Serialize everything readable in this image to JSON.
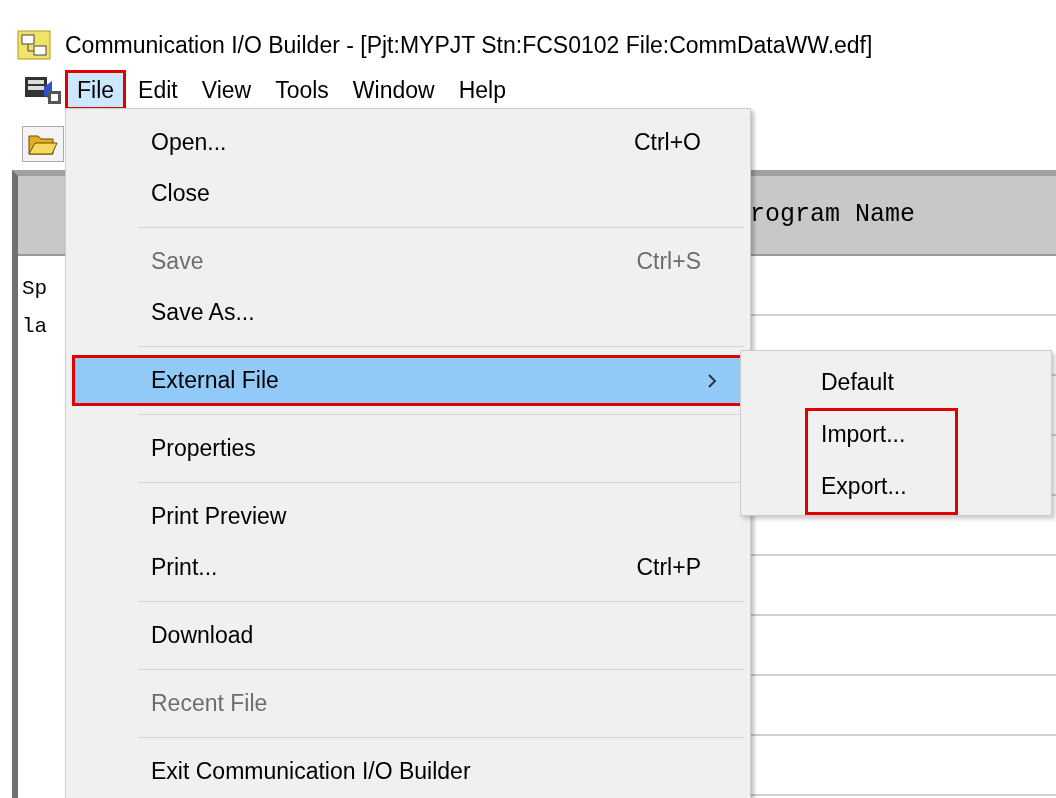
{
  "window": {
    "title": "Communication I/O Builder - [Pjt:MYPJT Stn:FCS0102 File:CommDataWW.edf]"
  },
  "menubar": [
    {
      "label": "File",
      "selected": true,
      "highlighted": true
    },
    {
      "label": "Edit",
      "selected": false,
      "highlighted": false
    },
    {
      "label": "View",
      "selected": false,
      "highlighted": false
    },
    {
      "label": "Tools",
      "selected": false,
      "highlighted": false
    },
    {
      "label": "Window",
      "selected": false,
      "highlighted": false
    },
    {
      "label": "Help",
      "selected": false,
      "highlighted": false
    }
  ],
  "file_menu": [
    {
      "kind": "item",
      "label": "Open...",
      "shortcut": "Ctrl+O",
      "disabled": false,
      "selected": false,
      "highlighted": false
    },
    {
      "kind": "item",
      "label": "Close",
      "disabled": false,
      "selected": false,
      "highlighted": false
    },
    {
      "kind": "separator"
    },
    {
      "kind": "item",
      "label": "Save",
      "shortcut": "Ctrl+S",
      "disabled": true,
      "selected": false,
      "highlighted": false
    },
    {
      "kind": "item",
      "label": "Save As...",
      "disabled": false,
      "selected": false,
      "highlighted": false
    },
    {
      "kind": "separator"
    },
    {
      "kind": "item",
      "label": "External File",
      "submenu": true,
      "disabled": false,
      "selected": true,
      "highlighted": true
    },
    {
      "kind": "separator"
    },
    {
      "kind": "item",
      "label": "Properties",
      "disabled": false,
      "selected": false,
      "highlighted": false
    },
    {
      "kind": "separator"
    },
    {
      "kind": "item",
      "label": "Print Preview",
      "disabled": false,
      "selected": false,
      "highlighted": false
    },
    {
      "kind": "item",
      "label": "Print...",
      "shortcut": "Ctrl+P",
      "disabled": false,
      "selected": false,
      "highlighted": false
    },
    {
      "kind": "separator"
    },
    {
      "kind": "item",
      "label": "Download",
      "disabled": false,
      "selected": false,
      "highlighted": false
    },
    {
      "kind": "separator"
    },
    {
      "kind": "item",
      "label": "Recent File",
      "disabled": true,
      "selected": false,
      "highlighted": false
    },
    {
      "kind": "separator"
    },
    {
      "kind": "item",
      "label": "Exit Communication I/O Builder",
      "disabled": false,
      "selected": false,
      "highlighted": false
    }
  ],
  "submenu": [
    {
      "label": "Default",
      "selected": false,
      "highlighted": false
    },
    {
      "label": "Import...",
      "selected": false,
      "highlighted": true
    },
    {
      "label": "Export...",
      "selected": false,
      "highlighted": true
    }
  ],
  "grid": {
    "header": "rogram Name",
    "cells": [
      "Sp",
      "la"
    ]
  }
}
